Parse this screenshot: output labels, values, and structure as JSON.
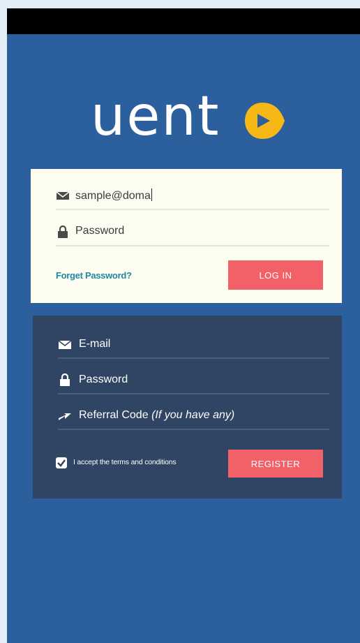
{
  "brand": {
    "logo_text": "uent",
    "logo_color": "#ffffff",
    "accent": "#f6b817"
  },
  "colors": {
    "background": "#2c5f9e",
    "login_card": "#fdfcf0",
    "register_card": "#2f4563",
    "button": "#f26167",
    "link": "#1f8aa6"
  },
  "login": {
    "email_value": "sample@doma",
    "email_icon": "envelope-icon",
    "password_placeholder": "Password",
    "password_icon": "lock-icon",
    "forgot_label": "Forget Password?",
    "login_label": "LOG IN"
  },
  "register": {
    "email_placeholder": "E-mail",
    "email_icon": "envelope-icon",
    "password_placeholder": "Password",
    "password_icon": "lock-icon",
    "referral_label": "Referral Code",
    "referral_hint": "(If you have any)",
    "referral_icon": "arrow-icon",
    "terms_label": "I accept the terms and conditions",
    "terms_checked": true,
    "register_label": "REGISTER"
  }
}
